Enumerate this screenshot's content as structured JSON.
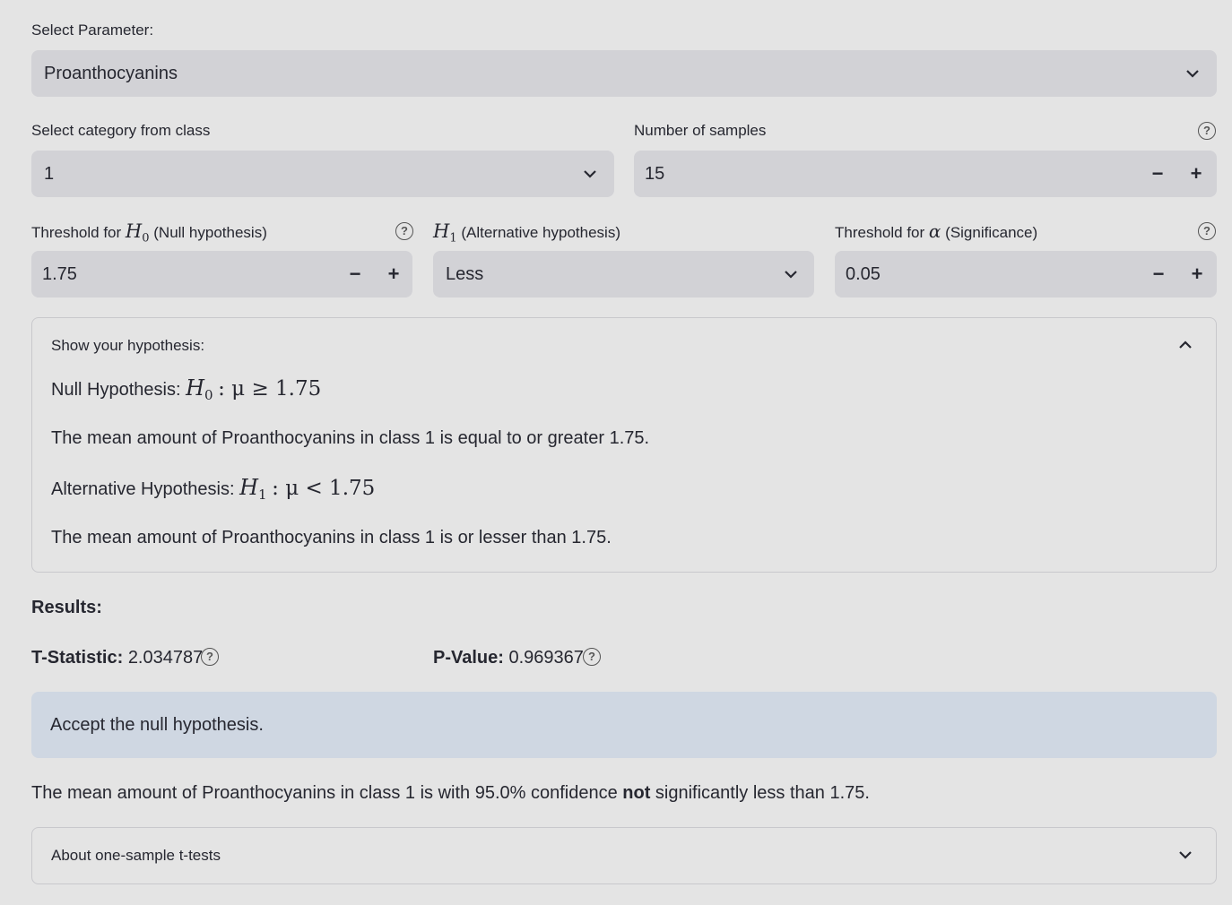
{
  "parameter": {
    "label": "Select Parameter:",
    "value": "Proanthocyanins"
  },
  "category": {
    "label": "Select category from class",
    "value": "1"
  },
  "samples": {
    "label": "Number of samples",
    "value": "15"
  },
  "h0_threshold": {
    "label_prefix": "Threshold for",
    "symbol": "H",
    "subscript": "0",
    "label_suffix": "(Null hypothesis)",
    "value": "1.75"
  },
  "h1": {
    "symbol": "H",
    "subscript": "1",
    "label_suffix": "(Alternative hypothesis)",
    "value": "Less"
  },
  "alpha": {
    "label_prefix": "Threshold for",
    "symbol": "α",
    "label_suffix": "(Significance)",
    "value": "0.05"
  },
  "hypothesis_panel": {
    "title": "Show your hypothesis:",
    "null_label": "Null Hypothesis:",
    "null_formula": ": μ ≥ 1.75",
    "null_text": "The mean amount of Proanthocyanins in class 1 is equal to or greater 1.75.",
    "alt_label": "Alternative Hypothesis:",
    "alt_formula": ": μ < 1.75",
    "alt_text": "The mean amount of Proanthocyanins in class 1 is or lesser than 1.75."
  },
  "results": {
    "heading": "Results:",
    "t_label": "T-Statistic:",
    "t_value": "2.034787",
    "p_label": "P-Value:",
    "p_value": "0.969367",
    "decision": "Accept the null hypothesis.",
    "conclusion_pre": "The mean amount of Proanthocyanins in class 1 is with 95.0% confidence",
    "conclusion_bold": "not",
    "conclusion_post": "significantly less than 1.75."
  },
  "about": {
    "title": "About one-sample t-tests"
  },
  "icons": {
    "dropdown": "chevron-down-icon",
    "collapse": "chevron-up-icon",
    "help": "question-circle-icon",
    "minus": "minus-icon",
    "plus": "plus-icon"
  }
}
